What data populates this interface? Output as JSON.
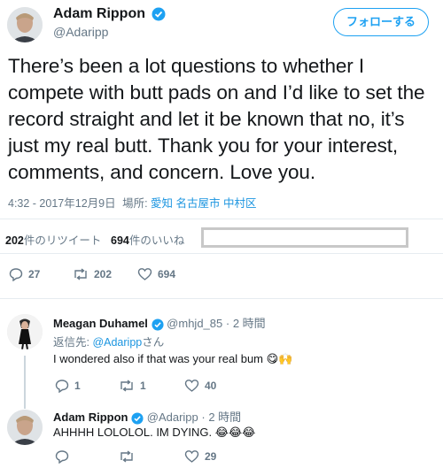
{
  "main_tweet": {
    "author_name": "Adam Rippon",
    "author_handle": "@Adaripp",
    "follow_label": "フォローする",
    "text": "There’s been a lot questions to whether I compete with butt pads on and I’d like to set the record straight and let it be known that no, it’s just my real butt. Thank you for your interest, comments, and concern. Love you.",
    "timestamp": "4:32 - 2017年12月9日",
    "location_label": "場所: ",
    "location_value": "愛知 名古屋市 中村区",
    "retweets_count": "202",
    "retweets_label": "件のリツイート",
    "likes_count": "694",
    "likes_label": "件のいいね",
    "actions": {
      "reply": "27",
      "retweet": "202",
      "like": "694"
    }
  },
  "replies": [
    {
      "author_name": "Meagan Duhamel",
      "author_handle": "@mhjd_85",
      "time": "· 2 時間",
      "reply_to_prefix": "返信先: ",
      "reply_to_handle": "@Adaripp",
      "reply_to_suffix": "さん",
      "text": "I wondered also if that was your real bum",
      "emoji": "😋🙌",
      "actions": {
        "reply": "1",
        "retweet": "1",
        "like": "40"
      }
    },
    {
      "author_name": "Adam Rippon",
      "author_handle": "@Adaripp",
      "time": "· 2 時間",
      "text": "AHHHH LOLOLOL. IM DYING.",
      "emoji": "😂😂😂",
      "actions": {
        "reply": "",
        "retweet": "",
        "like": "29"
      }
    }
  ],
  "colors": {
    "accent": "#1da1f2",
    "secondary_text": "#657786",
    "link": "#1b95e0"
  }
}
